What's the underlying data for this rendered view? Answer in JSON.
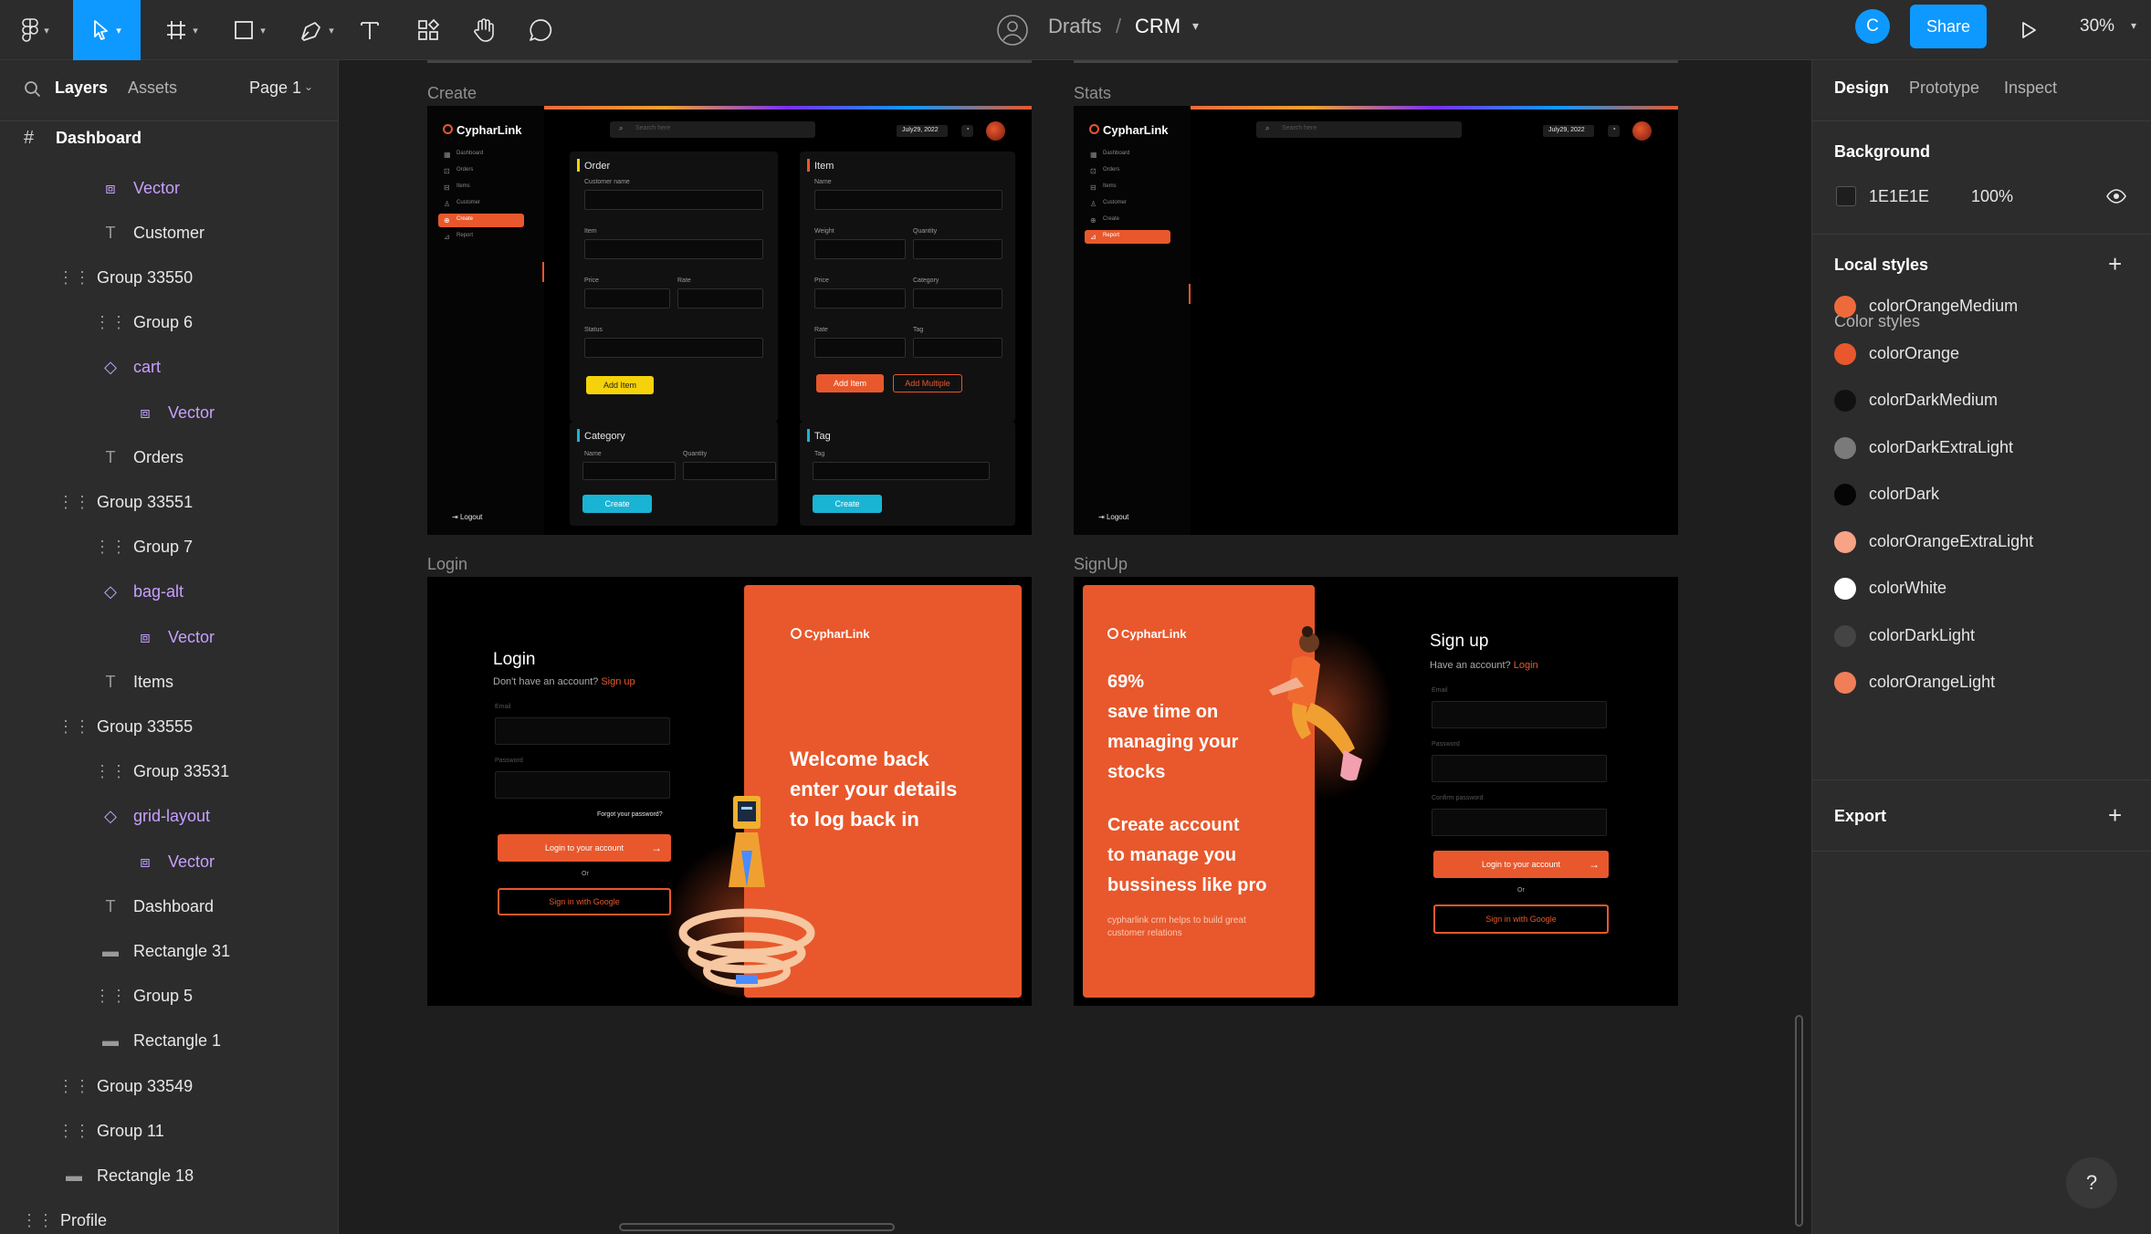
{
  "toolbar": {
    "breadcrumb_folder": "Drafts",
    "breadcrumb_sep": "/",
    "file_name": "CRM",
    "avatar_initial": "C",
    "share_label": "Share",
    "zoom": "30%",
    "accent": "#0d99ff"
  },
  "sidebar": {
    "tab_layers": "Layers",
    "tab_assets": "Assets",
    "page_selector": "Page 1",
    "root_frame": "Dashboard",
    "layers": [
      {
        "label": "Vector",
        "icon": "vector-icon",
        "purple": true
      },
      {
        "label": "Customer",
        "icon": "text-icon",
        "purple": false
      },
      {
        "label": "Group 33550",
        "icon": "group-icon",
        "purple": false
      },
      {
        "label": "Group 6",
        "icon": "group-icon",
        "purple": false
      },
      {
        "label": "cart",
        "icon": "component-instance-icon",
        "purple": true
      },
      {
        "label": "Vector",
        "icon": "vector-icon",
        "purple": true
      },
      {
        "label": "Orders",
        "icon": "text-icon",
        "purple": false
      },
      {
        "label": "Group 33551",
        "icon": "group-icon",
        "purple": false
      },
      {
        "label": "Group 7",
        "icon": "group-icon",
        "purple": false
      },
      {
        "label": "bag-alt",
        "icon": "component-instance-icon",
        "purple": true
      },
      {
        "label": "Vector",
        "icon": "vector-icon",
        "purple": true
      },
      {
        "label": "Items",
        "icon": "text-icon",
        "purple": false
      },
      {
        "label": "Group 33555",
        "icon": "group-icon",
        "purple": false
      },
      {
        "label": "Group 33531",
        "icon": "group-icon",
        "purple": false
      },
      {
        "label": "grid-layout",
        "icon": "component-instance-icon",
        "purple": true
      },
      {
        "label": "Vector",
        "icon": "vector-icon",
        "purple": true
      },
      {
        "label": "Dashboard",
        "icon": "text-icon",
        "purple": false
      },
      {
        "label": "Rectangle 31",
        "icon": "rectangle-icon",
        "purple": false
      },
      {
        "label": "Group 5",
        "icon": "group-icon",
        "purple": false
      },
      {
        "label": "Rectangle 1",
        "icon": "rectangle-icon",
        "purple": false
      },
      {
        "label": "Group 33549",
        "icon": "group-icon",
        "purple": false
      },
      {
        "label": "Group 11",
        "icon": "group-icon",
        "purple": false
      },
      {
        "label": "Rectangle 18",
        "icon": "rectangle-icon",
        "purple": false
      },
      {
        "label": "Profile",
        "icon": "group-icon",
        "purple": false
      }
    ]
  },
  "canvas": {
    "frames": {
      "create": "Create",
      "stats": "Stats",
      "login": "Login",
      "signup": "SignUp"
    },
    "app": {
      "logo": "CypharLink",
      "search_placeholder": "Search here",
      "date": "July29, 2022",
      "nav": [
        "Dashboard",
        "Orders",
        "Items",
        "Customer",
        "Create",
        "Report"
      ],
      "logout": "Logout"
    },
    "create_form": {
      "order_title": "Order",
      "order_fields": [
        "Customer name",
        "Item",
        "Price",
        "Rate",
        "Status"
      ],
      "order_btn": "Add Item",
      "item_title": "Item",
      "item_fields": [
        "Name",
        "Weight",
        "Quantity",
        "Price",
        "Category",
        "Rate",
        "Tag"
      ],
      "item_btn1": "Add Item",
      "item_btn2": "Add Multiple",
      "category_title": "Category",
      "category_fields": [
        "Name",
        "Quantity"
      ],
      "category_btn": "Create",
      "tag_title": "Tag",
      "tag_fields": [
        "Tag"
      ],
      "tag_btn": "Create"
    },
    "login": {
      "title": "Login",
      "subtitle": "Don't have an account?",
      "subtitle_link": "Sign up",
      "email_label": "Email",
      "password_label": "Password",
      "forgot": "Forgot your password?",
      "login_btn": "Login to your account",
      "or": "Or",
      "google_btn": "Sign in with Google",
      "welcome_line1": "Welcome back",
      "welcome_line2": "enter your  details",
      "welcome_line3": "to log back in"
    },
    "signup": {
      "title": "Sign up",
      "subtitle": "Have an account?",
      "subtitle_link": "Login",
      "email_label": "Email",
      "password_label": "Password",
      "confirm_label": "Confirm password",
      "login_btn": "Login to your account",
      "or": "Or",
      "google_btn": "Sign in with Google",
      "stat_line1": "69%",
      "stat_line2": "save time on",
      "stat_line3": "managing your",
      "stat_line4": "stocks",
      "cta_line1": "Create account",
      "cta_line2": "to manage you",
      "cta_line3": "bussiness like pro",
      "footnote_line1": "cypharlink crm helps to build great",
      "footnote_line2": "customer relations"
    }
  },
  "right_panel": {
    "tab_design": "Design",
    "tab_prototype": "Prototype",
    "tab_inspect": "Inspect",
    "background_title": "Background",
    "bg_hex": "1E1E1E",
    "bg_opacity": "100%",
    "local_styles_title": "Local styles",
    "color_styles_title": "Color styles",
    "color_styles": [
      {
        "name": "colorOrangeMedium",
        "color": "#ee6a3c"
      },
      {
        "name": "colorOrange",
        "color": "#e8582c"
      },
      {
        "name": "colorDarkMedium",
        "color": "#111111"
      },
      {
        "name": "colorDarkExtraLight",
        "color": "#7a7a7a"
      },
      {
        "name": "colorDark",
        "color": "#050505"
      },
      {
        "name": "colorOrangeExtraLight",
        "color": "#f6a386"
      },
      {
        "name": "colorWhite",
        "color": "#ffffff"
      },
      {
        "name": "colorDarkLight",
        "color": "#444444"
      },
      {
        "name": "colorOrangeLight",
        "color": "#f07f59"
      }
    ],
    "export_title": "Export",
    "help": "?"
  }
}
